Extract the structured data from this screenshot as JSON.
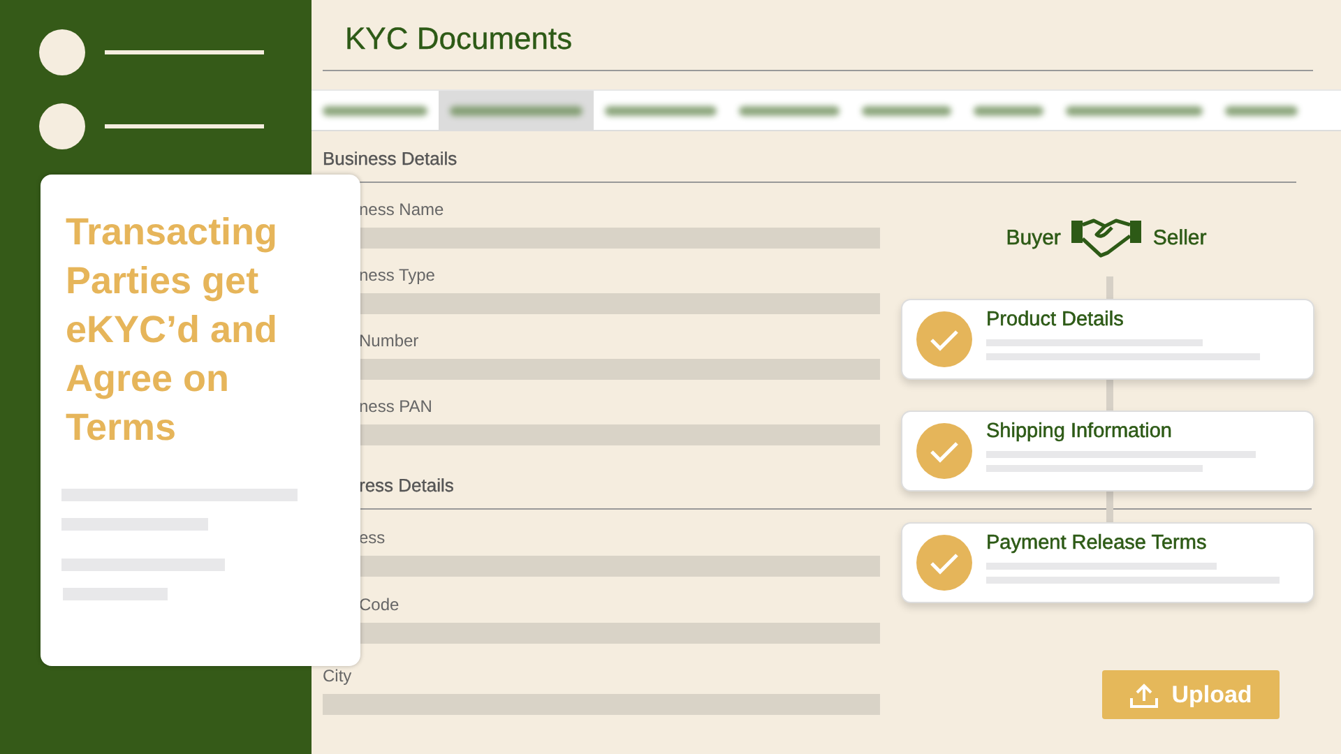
{
  "info_card": {
    "title": "Transacting Parties get eKYC’d and Agree on Terms"
  },
  "page": {
    "title": "KYC Documents"
  },
  "tabs": [
    {
      "selected": false
    },
    {
      "selected": true
    },
    {
      "selected": false
    },
    {
      "selected": false
    },
    {
      "selected": false
    },
    {
      "selected": false
    },
    {
      "selected": false
    },
    {
      "selected": false
    }
  ],
  "sections": [
    {
      "title": "Business Details",
      "fields": [
        {
          "label": "ness Name"
        },
        {
          "label": "ness Type"
        },
        {
          "label": "Number"
        },
        {
          "label": "ness PAN"
        }
      ]
    },
    {
      "title": "ress Details",
      "fields": [
        {
          "label": "ess"
        },
        {
          "label": "Code"
        },
        {
          "label": "City"
        }
      ]
    }
  ],
  "parties": {
    "buyer": "Buyer",
    "seller": "Seller"
  },
  "steps": [
    {
      "title": "Product Details",
      "checked": true
    },
    {
      "title": "Shipping Information",
      "checked": true
    },
    {
      "title": "Payment Release Terms",
      "checked": true
    }
  ],
  "upload_button": {
    "label": "Upload"
  }
}
